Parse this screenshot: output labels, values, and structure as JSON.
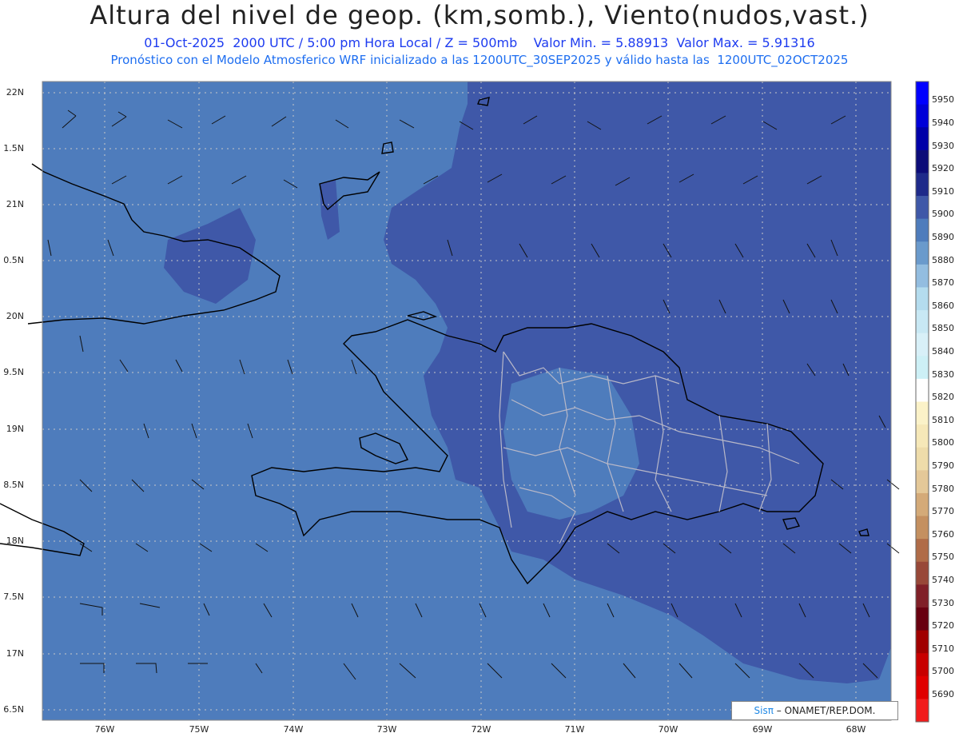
{
  "header": {
    "title": "Altura del nivel de geop. (km,somb.), Viento(nudos,vast.)",
    "line1": "01-Oct-2025  2000 UTC / 5:00 pm Hora Local / Z = 500mb    Valor Min. = 5.88913  Valor Max. = 5.91316",
    "line2": "Pronóstico con el Modelo Atmosferico WRF inicializado a las 1200UTC_30SEP2025 y válido hasta las  1200UTC_02OCT2025"
  },
  "axes": {
    "lat_labels": [
      "22N",
      "1.5N",
      "21N",
      "0.5N",
      "20N",
      "9.5N",
      "19N",
      "8.5N",
      "18N",
      "7.5N",
      "17N",
      "6.5N"
    ],
    "lon_labels": [
      "76W",
      "75W",
      "74W",
      "73W",
      "72W",
      "71W",
      "70W",
      "69W",
      "68W"
    ]
  },
  "colorbar": {
    "labels": [
      "5950",
      "5940",
      "5930",
      "5920",
      "5910",
      "5900",
      "5890",
      "5880",
      "5870",
      "5860",
      "5850",
      "5840",
      "5830",
      "5820",
      "5810",
      "5800",
      "5790",
      "5780",
      "5770",
      "5760",
      "5750",
      "5740",
      "5730",
      "5720",
      "5710",
      "5700",
      "5690"
    ],
    "colors": [
      "#0000ff",
      "#0000d8",
      "#0000a8",
      "#0c0c78",
      "#1e2a8a",
      "#3f58a8",
      "#4e7cbc",
      "#6a9acc",
      "#93bde0",
      "#b4dcee",
      "#c8e8f4",
      "#d8f0f8",
      "#cdf0f6",
      "#ffffff",
      "#fbf2c8",
      "#f6e8b8",
      "#eedcaa",
      "#e4c898",
      "#d4aa78",
      "#c49060",
      "#b06c48",
      "#984838",
      "#802028",
      "#680010",
      "#a00000",
      "#c80000",
      "#e00000",
      "#f21c1c"
    ]
  },
  "credit": {
    "prefix": "Sisπ",
    "text": " – ONAMET/REP.DOM."
  }
}
